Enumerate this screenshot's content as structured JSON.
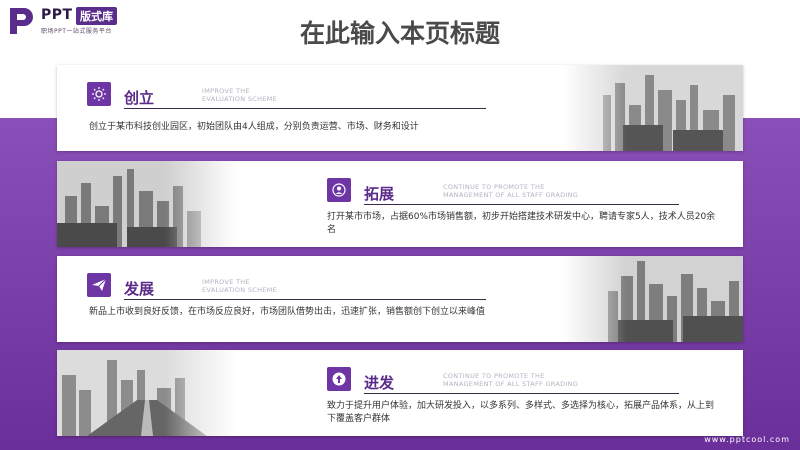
{
  "logo": {
    "brand": "PPT",
    "tag": "版式库",
    "sub": "职场PPT一站式服务平台"
  },
  "title": "在此输入本页标题",
  "cards": [
    {
      "title": "创立",
      "sub": "IMPROVE THE\nEVALUATION SCHEME",
      "icon": "sun-icon",
      "desc": "创立于某市科技创业园区，初始团队由4人组成，分别负责运营、市场、财务和设计"
    },
    {
      "title": "拓展",
      "sub": "CONTINUE TO PROMOTE THE\nMANAGEMENT OF ALL STAFF GRADING",
      "icon": "user-icon",
      "desc": "打开某市市场，占据60%市场销售额，初步开始搭建技术研发中心，聘请专家5人，技术人员20余名"
    },
    {
      "title": "发展",
      "sub": "IMPROVE THE\nEVALUATION SCHEME",
      "icon": "paper-plane-icon",
      "desc": "新品上市收到良好反馈，在市场反应良好，市场团队借势出击，迅速扩张，销售额创下创立以来峰值"
    },
    {
      "title": "进发",
      "sub": "CONTINUE TO PROMOTE THE\nMANAGEMENT OF ALL STAFF GRADING",
      "icon": "arrow-up-circle-icon",
      "desc": "致力于提升用户体验，加大研发投入，以多系列、多样式、多选择为核心，拓展产品体系，从上到下覆盖客户群体"
    }
  ],
  "footer": "www.pptcool.com",
  "colors": {
    "accent": "#6e35a4",
    "band": "#7a3fae"
  }
}
